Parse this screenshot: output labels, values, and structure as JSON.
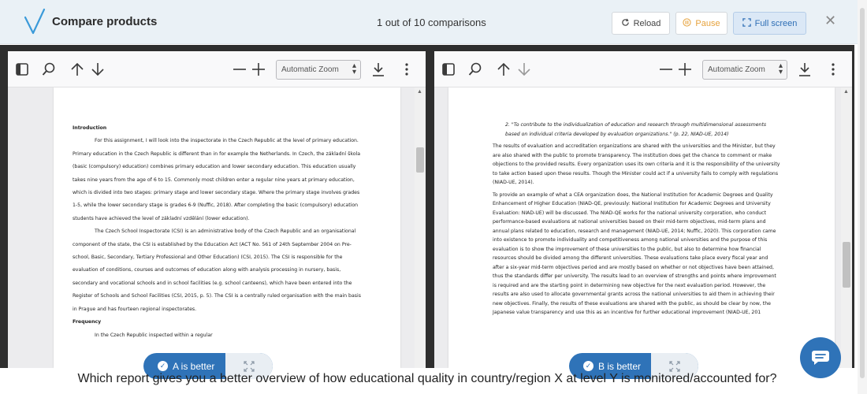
{
  "header": {
    "title": "Compare products",
    "counter": "1 out of 10 comparisons",
    "reload_label": "Reload",
    "pause_label": "Pause",
    "fullscreen_label": "Full screen",
    "close_symbol": "✕"
  },
  "left_viewer": {
    "zoom_value": "Automatic Zoom",
    "doc": {
      "heading": "Introduction",
      "paragraphs": [
        "For this assignment, I will look into the inspectorate in the Czech Republic at the level of primary education. Primary education in the Czech Republic is different than in for example the Netherlands. In Czech, the základní škola (basic (compulsory) education) combines primary education and lower secondary education. This education usually takes nine years from the age of 6 to 15. Commonly most children enter a regular nine years at primary education, which is divided into two stages: primary stage and lower secondary stage. Where the primary stage involves grades 1-5, while the lower secondary stage is grades 6-9 (Nuffic, 2018). After completing the basic (compulsory) education students have achieved the level of základní vzdělání (lower education).",
        "The Czech School Inspectorate (CSI) is an administrative body of the Czech Republic and an organisational component of the state, the CSI is established by the Education Act (ACT No. 561 of 24th September 2004 on Pre-school, Basic, Secondary, Tertiary Professional and Other Education) (CSI, 2015). The CSI is responsible for the evaluation of conditions, courses and outcomes of education along with analysis processing in nursery, basis, secondary and vocational schools and in school facilities (e.g. school canteens), which have been entered into the Register of Schools and School Facilities (CSI, 2015, p. 5). The CSI is a centrally ruled organisation with the main basis in Prague and has fourteen regional inspectorates."
      ],
      "heading2": "Frequency",
      "tail": "In the Czech Republic inspected within a regular"
    }
  },
  "right_viewer": {
    "zoom_value": "Automatic Zoom",
    "doc": {
      "quote": "2.  \"To contribute to the individualization of education and research through multidimensional assessments based on individual criteria developed by evaluation organizations.\" (p. 22, NIAD-UE, 2014)",
      "paragraphs": [
        "The results of evaluation and accreditation organizations are shared with the universities and the Minister, but they are also shared with the public to promote transparency. The institution does get the chance to comment or make objections to the provided results. Every organization uses its own criteria and it is the responsibility of the university to take action based upon these results. Though the Minister could act if a university fails to comply with regulations (NIAD-UE, 2014).",
        "To provide an example of what a CEA organization does, the National Institution for Academic Degrees and Quality Enhancement of Higher Education (NIAD-QE, previously: National Institution for Academic Degrees and University Evaluation: NIAD-UE) will be discussed. The NIAD-QE works for the national university corporation, who conduct performance-based evaluations at national universities based on their mid-term objectives, mid-term plans and annual plans related to education, research and management (NIAD-UE, 2014; Nuffic, 2020). This corporation came into existence to promote individuality and competitiveness among national universities and the purpose of this evaluation is to show the improvement of these universities to the public, but also to determine how financial resources should be divided among the different universities. These evaluations take place every fiscal year and after a six-year mid-term objectives period and are mostly based on whether or not objectives have been attained, thus the standards differ per university. The results lead to an overview of strengths and points where improvement is required and are the starting point in determining new objective for the next evaluation period. However, the results are also used to allocate governmental grants across the national universities to aid them in achieving their new objectives. Finally, the results of these evaluations are shared with the public, as should be clear by now, the Japanese value transparency and use this as an incentive for further educational improvement (NIAD-UE, 201"
      ]
    }
  },
  "choices": {
    "a_label": "A is better",
    "b_label": "B is better"
  },
  "question": "Which report gives you a better overview of how educational quality in country/region X at level Y is monitored/accounted for?",
  "colors": {
    "accent": "#2f73b8",
    "pause": "#e6a23c",
    "frame": "#2e2e2e",
    "header_bg": "#eaf1f6"
  },
  "icons": {
    "logo": "checkmark-v-logo",
    "reload": "reload-icon",
    "pause": "pause-icon",
    "fullscreen": "fullscreen-icon",
    "sidebar": "sidebar-toggle-icon",
    "search": "search-icon",
    "prev": "arrow-up-icon",
    "next": "arrow-down-icon",
    "zoom_out": "minus-icon",
    "zoom_in": "plus-icon",
    "download": "download-icon",
    "more": "more-vertical-icon",
    "expand": "expand-icon",
    "chat": "chat-icon"
  }
}
